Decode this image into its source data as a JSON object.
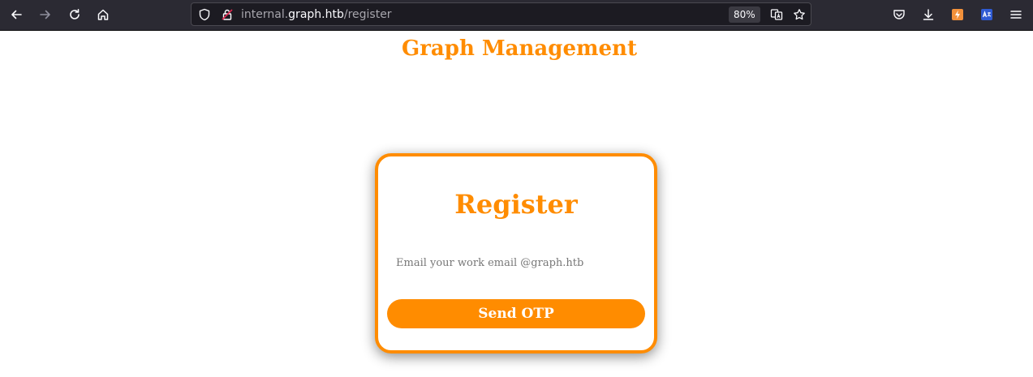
{
  "browser": {
    "url_prefix": "internal.",
    "url_host": "graph.htb",
    "url_path": "/register",
    "zoom": "80%"
  },
  "page": {
    "site_title": "Graph Management"
  },
  "register_card": {
    "title": "Register",
    "email_placeholder": "Email your work email @graph.htb",
    "email_value": "",
    "submit_label": "Send OTP"
  },
  "colors": {
    "accent": "#ff8c00",
    "toolbar_bg": "#2b2a33",
    "urlbar_bg": "#1c1b22"
  }
}
